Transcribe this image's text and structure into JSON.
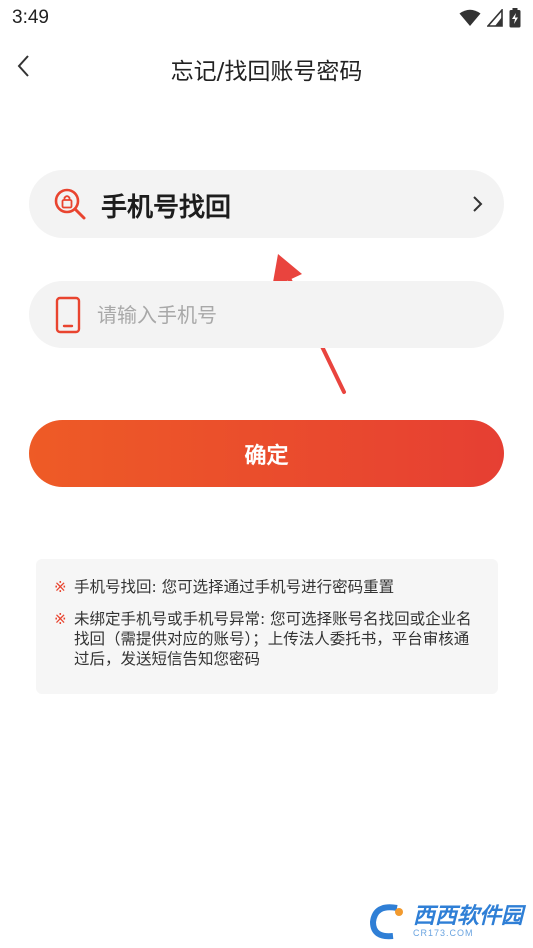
{
  "status_bar": {
    "time": "3:49",
    "icons": [
      "wifi-icon",
      "signal-icon",
      "battery-charging-icon"
    ]
  },
  "header": {
    "title": "忘记/找回账号密码",
    "back_icon": "chevron-left-icon"
  },
  "method": {
    "label": "手机号找回",
    "icon": "search-lock-icon",
    "chevron_icon": "chevron-right-icon"
  },
  "phone": {
    "icon": "phone-icon",
    "value": "",
    "placeholder": "请输入手机号"
  },
  "confirm_label": "确定",
  "info": {
    "mark": "※",
    "items": [
      "手机号找回: 您可选择通过手机号进行密码重置",
      "未绑定手机号或手机号异常: 您可选择账号名找回或企业名找回（需提供对应的账号）；上传法人委托书，平台审核通过后，发送短信告知您密码"
    ]
  },
  "watermark": {
    "text": "西西软件园",
    "sub": "CR173.COM"
  },
  "colors": {
    "accent": "#e9442f",
    "button_start": "#ee5b26",
    "button_end": "#e63f33",
    "field_bg": "#f3f3f3",
    "info_bg": "#f6f6f6"
  }
}
